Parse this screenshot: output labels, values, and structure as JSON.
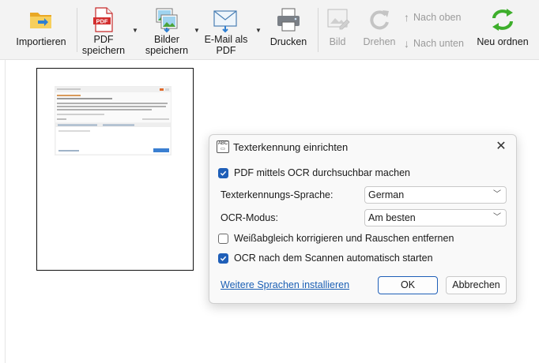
{
  "toolbar": {
    "import_label": "Importieren",
    "pdf_label_1": "PDF",
    "pdf_label_2": "speichern",
    "images_label_1": "Bilder",
    "images_label_2": "speichern",
    "email_label_1": "E-Mail als",
    "email_label_2": "PDF",
    "print_label": "Drucken",
    "image_label": "Bild",
    "rotate_label": "Drehen",
    "move_up_label": "Nach oben",
    "move_down_label": "Nach unten",
    "reorder_label": "Neu ordnen",
    "pdf_icon_text": "PDF",
    "icons": {
      "import": "folder-import-icon",
      "pdf": "pdf-file-icon",
      "images": "image-stack-icon",
      "email": "envelope-icon",
      "print": "printer-icon",
      "image": "image-edit-icon",
      "rotate": "rotate-icon",
      "move_up": "arrow-up-icon",
      "move_down": "arrow-down-icon",
      "reorder": "refresh-icon"
    }
  },
  "dialog": {
    "title": "Texterkennung einrichten",
    "ocr_searchable": {
      "label": "PDF mittels OCR durchsuchbar machen",
      "checked": true
    },
    "language_label": "Texterkennungs-Sprache:",
    "language_value": "German",
    "mode_label": "OCR-Modus:",
    "mode_value": "Am besten",
    "white_balance": {
      "label": "Weißabgleich korrigieren und Rauschen entfernen",
      "checked": false
    },
    "auto_ocr": {
      "label": "OCR nach dem Scannen automatisch starten",
      "checked": true
    },
    "more_languages_link": "Weitere Sprachen installieren",
    "ok_label": "OK",
    "cancel_label": "Abbrechen"
  },
  "colors": {
    "accent": "#1f5fb8",
    "link": "#1a5fb4",
    "pdf_red": "#d32f2f",
    "reorder_green": "#3dae2b",
    "folder_yellow": "#f2c14e"
  }
}
